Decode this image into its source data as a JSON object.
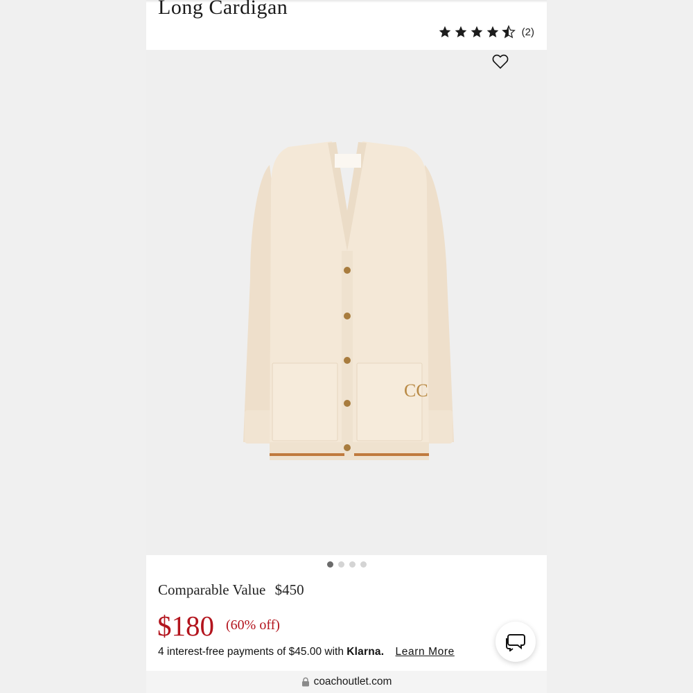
{
  "product": {
    "title": "Long Cardigan",
    "rating_value": 4.5,
    "rating_max": 5,
    "review_count": "(2)"
  },
  "gallery": {
    "image_count": 4,
    "active_index": 0,
    "favorite_icon": "heart-outline-icon"
  },
  "pricing": {
    "comparable_label": "Comparable Value",
    "comparable_value": "$450",
    "sale_price": "$180",
    "discount": "(60% off)",
    "installments_text": "4 interest-free payments of $45.00 with",
    "installments_brand": "Klarna.",
    "learn_more": "Learn More"
  },
  "chat": {
    "icon": "chat-bubbles-icon"
  },
  "browser": {
    "url": "coachoutlet.com",
    "lock_icon": "lock-icon"
  },
  "colors": {
    "sale_red": "#b3141d",
    "image_bg": "#efefef",
    "garment": "#f3e6d4",
    "trim_accent": "#c07a3e"
  }
}
